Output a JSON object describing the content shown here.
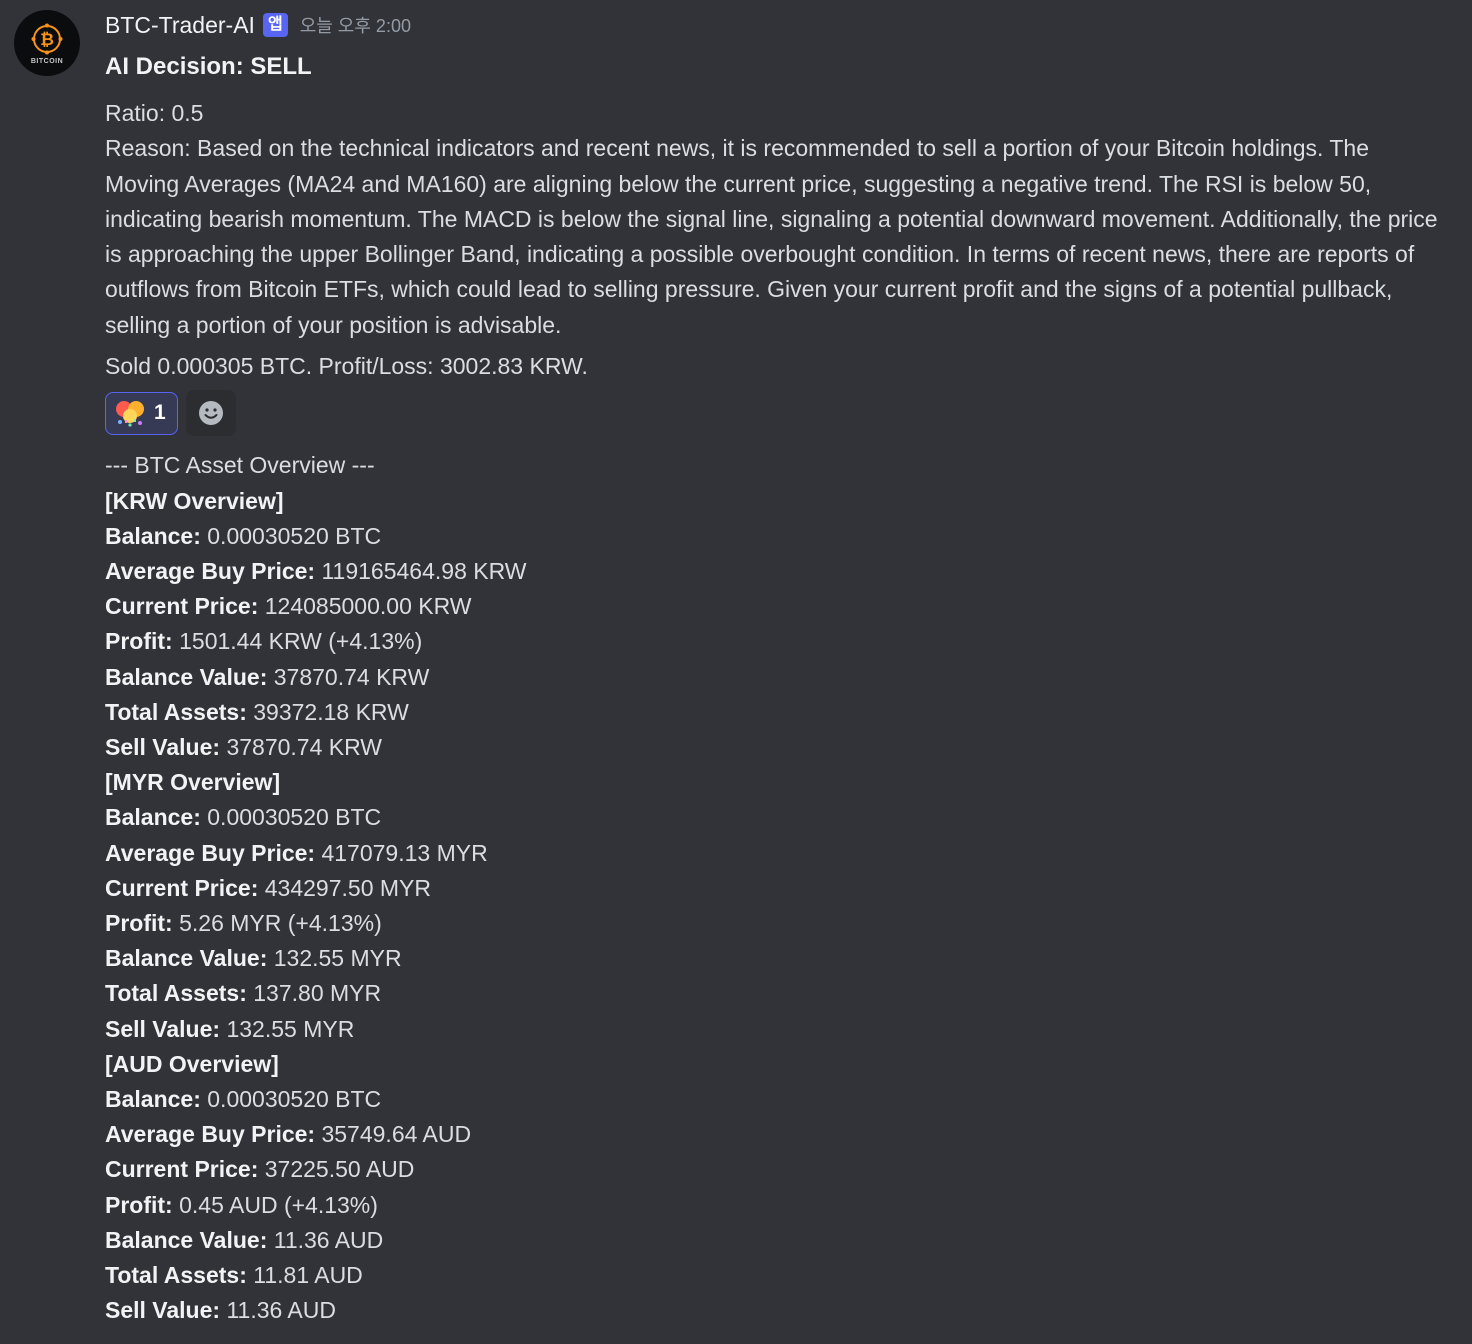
{
  "message": {
    "avatar_label": "BITCOIN",
    "author": "BTC-Trader-AI",
    "app_badge": "앱",
    "timestamp": "오늘 오후 2:00",
    "decision": "AI Decision: SELL",
    "ratio": "Ratio: 0.5",
    "reason": "Reason: Based on the technical indicators and recent news, it is recommended to sell a portion of your Bitcoin holdings. The Moving Averages (MA24 and MA160) are aligning below the current price, suggesting a negative trend. The RSI is below 50, indicating bearish momentum. The MACD is below the signal line, signaling a potential downward movement. Additionally, the price is approaching the upper Bollinger Band, indicating a possible overbought condition. In terms of recent news, there are reports of outflows from Bitcoin ETFs, which could lead to selling pressure. Given your current profit and the signs of a potential pullback, selling a portion of your position is advisable.",
    "sold": "Sold 0.000305 BTC. Profit/Loss: 3002.83 KRW."
  },
  "reactions": [
    {
      "icon": "party-emoji",
      "count": "1"
    }
  ],
  "add_reaction_icon": "smiley-add-icon",
  "overview": {
    "title": "--- BTC Asset Overview ---",
    "sections": [
      {
        "header": "[KRW Overview]",
        "rows": [
          {
            "label": "Balance:",
            "value": "0.00030520 BTC"
          },
          {
            "label": "Average Buy Price:",
            "value": "119165464.98 KRW"
          },
          {
            "label": "Current Price:",
            "value": "124085000.00 KRW"
          },
          {
            "label": "Profit:",
            "value": "1501.44 KRW (+4.13%)"
          },
          {
            "label": "Balance Value:",
            "value": "37870.74 KRW"
          },
          {
            "label": "Total Assets:",
            "value": "39372.18 KRW"
          },
          {
            "label": "Sell Value:",
            "value": "37870.74 KRW"
          }
        ]
      },
      {
        "header": "[MYR Overview]",
        "rows": [
          {
            "label": "Balance:",
            "value": "0.00030520 BTC"
          },
          {
            "label": "Average Buy Price:",
            "value": "417079.13 MYR"
          },
          {
            "label": "Current Price:",
            "value": "434297.50 MYR"
          },
          {
            "label": "Profit:",
            "value": "5.26 MYR (+4.13%)"
          },
          {
            "label": "Balance Value:",
            "value": "132.55 MYR"
          },
          {
            "label": "Total Assets:",
            "value": "137.80 MYR"
          },
          {
            "label": "Sell Value:",
            "value": "132.55 MYR"
          }
        ]
      },
      {
        "header": "[AUD Overview]",
        "rows": [
          {
            "label": "Balance:",
            "value": "0.00030520 BTC"
          },
          {
            "label": "Average Buy Price:",
            "value": "35749.64 AUD"
          },
          {
            "label": "Current Price:",
            "value": "37225.50 AUD"
          },
          {
            "label": "Profit:",
            "value": "0.45 AUD (+4.13%)"
          },
          {
            "label": "Balance Value:",
            "value": "11.36 AUD"
          },
          {
            "label": "Total Assets:",
            "value": "11.81 AUD"
          },
          {
            "label": "Sell Value:",
            "value": "11.36 AUD"
          }
        ]
      }
    ]
  },
  "colors": {
    "background": "#313338",
    "app_badge": "#5865f2",
    "bitcoin_orange": "#f7931a",
    "reaction_border": "#5865f2"
  }
}
